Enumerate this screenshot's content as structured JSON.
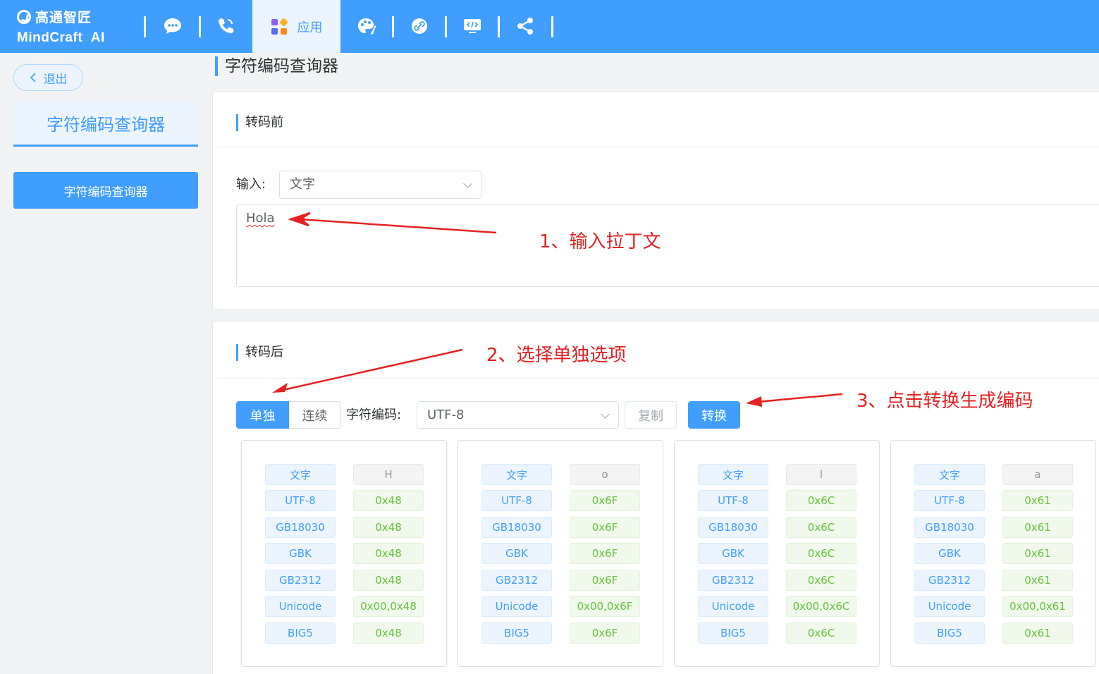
{
  "brand": {
    "cn": "高通智匠",
    "en_a": "MindCraft",
    "en_b": "AI"
  },
  "nav": {
    "icons": [
      "chat-icon",
      "phone-icon",
      "apps-icon",
      "palette-icon",
      "link-icon",
      "code-icon",
      "share-icon"
    ],
    "active_label": "应用"
  },
  "sidebar": {
    "exit_label": "退出",
    "title": "字符编码查询器",
    "items": [
      {
        "label": "字符编码查询器"
      }
    ]
  },
  "page": {
    "title": "字符编码查询器"
  },
  "before": {
    "section_title": "转码前",
    "input_label": "输入:",
    "input_type": "文字",
    "text_value": "Hola"
  },
  "after": {
    "section_title": "转码后",
    "mode_single": "单独",
    "mode_continuous": "连续",
    "encoding_label": "字符编码:",
    "encoding_value": "UTF-8",
    "copy_label": "复制",
    "convert_label": "转换"
  },
  "results": {
    "keys": [
      "文字",
      "UTF-8",
      "GB18030",
      "GBK",
      "GB2312",
      "Unicode",
      "BIG5"
    ],
    "cards": [
      {
        "values": [
          "H",
          "0x48",
          "0x48",
          "0x48",
          "0x48",
          "0x00,0x48",
          "0x48"
        ]
      },
      {
        "values": [
          "o",
          "0x6F",
          "0x6F",
          "0x6F",
          "0x6F",
          "0x00,0x6F",
          "0x6F"
        ]
      },
      {
        "values": [
          "l",
          "0x6C",
          "0x6C",
          "0x6C",
          "0x6C",
          "0x00,0x6C",
          "0x6C"
        ]
      },
      {
        "values": [
          "a",
          "0x61",
          "0x61",
          "0x61",
          "0x61",
          "0x00,0x61",
          "0x61"
        ]
      }
    ]
  },
  "annotations": {
    "step1": "1、输入拉丁文",
    "step2": "2、选择单独选项",
    "step3": "3、点击转换生成编码",
    "color": "#e52020"
  },
  "colors": {
    "primary": "#409eff",
    "success": "#67c23a"
  }
}
